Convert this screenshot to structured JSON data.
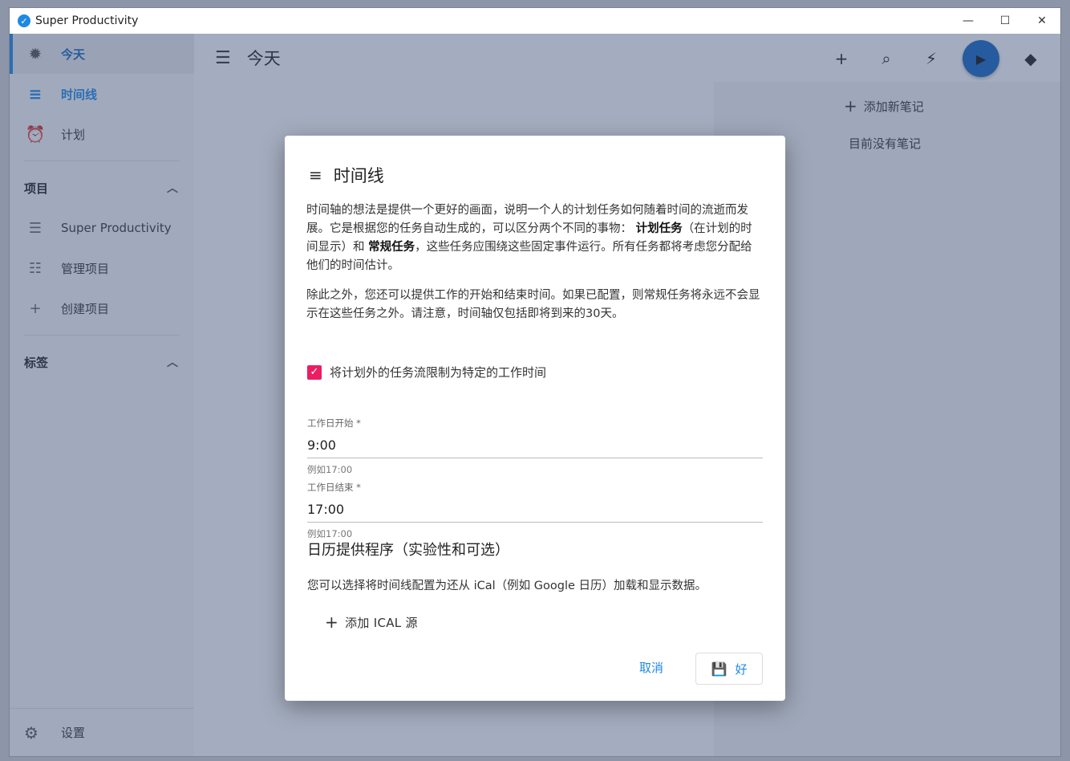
{
  "window": {
    "title": "Super Productivity",
    "controls": [
      "—",
      "☐",
      "✕"
    ]
  },
  "sidebar": {
    "items": [
      {
        "label": "今天",
        "icon": "sun-icon"
      },
      {
        "label": "时间线",
        "icon": "timeline-icon"
      },
      {
        "label": "计划",
        "icon": "alarm-icon"
      }
    ],
    "projects_header": "项目",
    "projects": [
      {
        "label": "Super Productivity",
        "icon": "list-icon"
      },
      {
        "label": "管理项目",
        "icon": "manage-list-icon"
      },
      {
        "label": "创建项目",
        "icon": "plus-icon"
      }
    ],
    "tags_header": "标签",
    "settings_label": "设置"
  },
  "header": {
    "title": "今天",
    "actions": [
      "add-icon",
      "search-icon",
      "bolt-icon",
      "play-icon",
      "diamond-icon"
    ]
  },
  "notes": {
    "add_label": "添加新笔记",
    "empty_label": "目前没有笔记"
  },
  "dialog": {
    "title": "时间线",
    "para1_a": "时间轴的想法是提供一个更好的画面，说明一个人的计划任务如何随着时间的流逝而发展。它是根据您的任务自动生成的，可以区分两个不同的事物：",
    "para1_b": "计划任务",
    "para1_c": "（在计划的时间显示）和",
    "para1_d": "常规任务",
    "para1_e": "，这些任务应围绕这些固定事件运行。所有任务都将考虑您分配给他们的时间估计。",
    "para2": "除此之外，您还可以提供工作的开始和结束时间。如果已配置，则常规任务将永远不会显示在这些任务之外。请注意，时间轴仅包括即将到来的30天。",
    "checkbox_label": "将计划外的任务流限制为特定的工作时间",
    "checkbox_checked": true,
    "start_label": "工作日开始 *",
    "start_value": "9:00",
    "start_hint": "例如17:00",
    "end_label": "工作日结束 *",
    "end_value": "17:00",
    "end_hint": "例如17:00",
    "calendar_title": "日历提供程序（实验性和可选）",
    "calendar_desc": "您可以选择将时间线配置为还从 iCal（例如 Google 日历）加载和显示数据。",
    "add_ical_label": "添加 ICAL 源",
    "cancel_label": "取消",
    "ok_label": "好"
  },
  "colors": {
    "accent": "#1e88e5",
    "checkbox": "#e91e63",
    "overlay": "rgba(60,80,120,0.45)"
  }
}
